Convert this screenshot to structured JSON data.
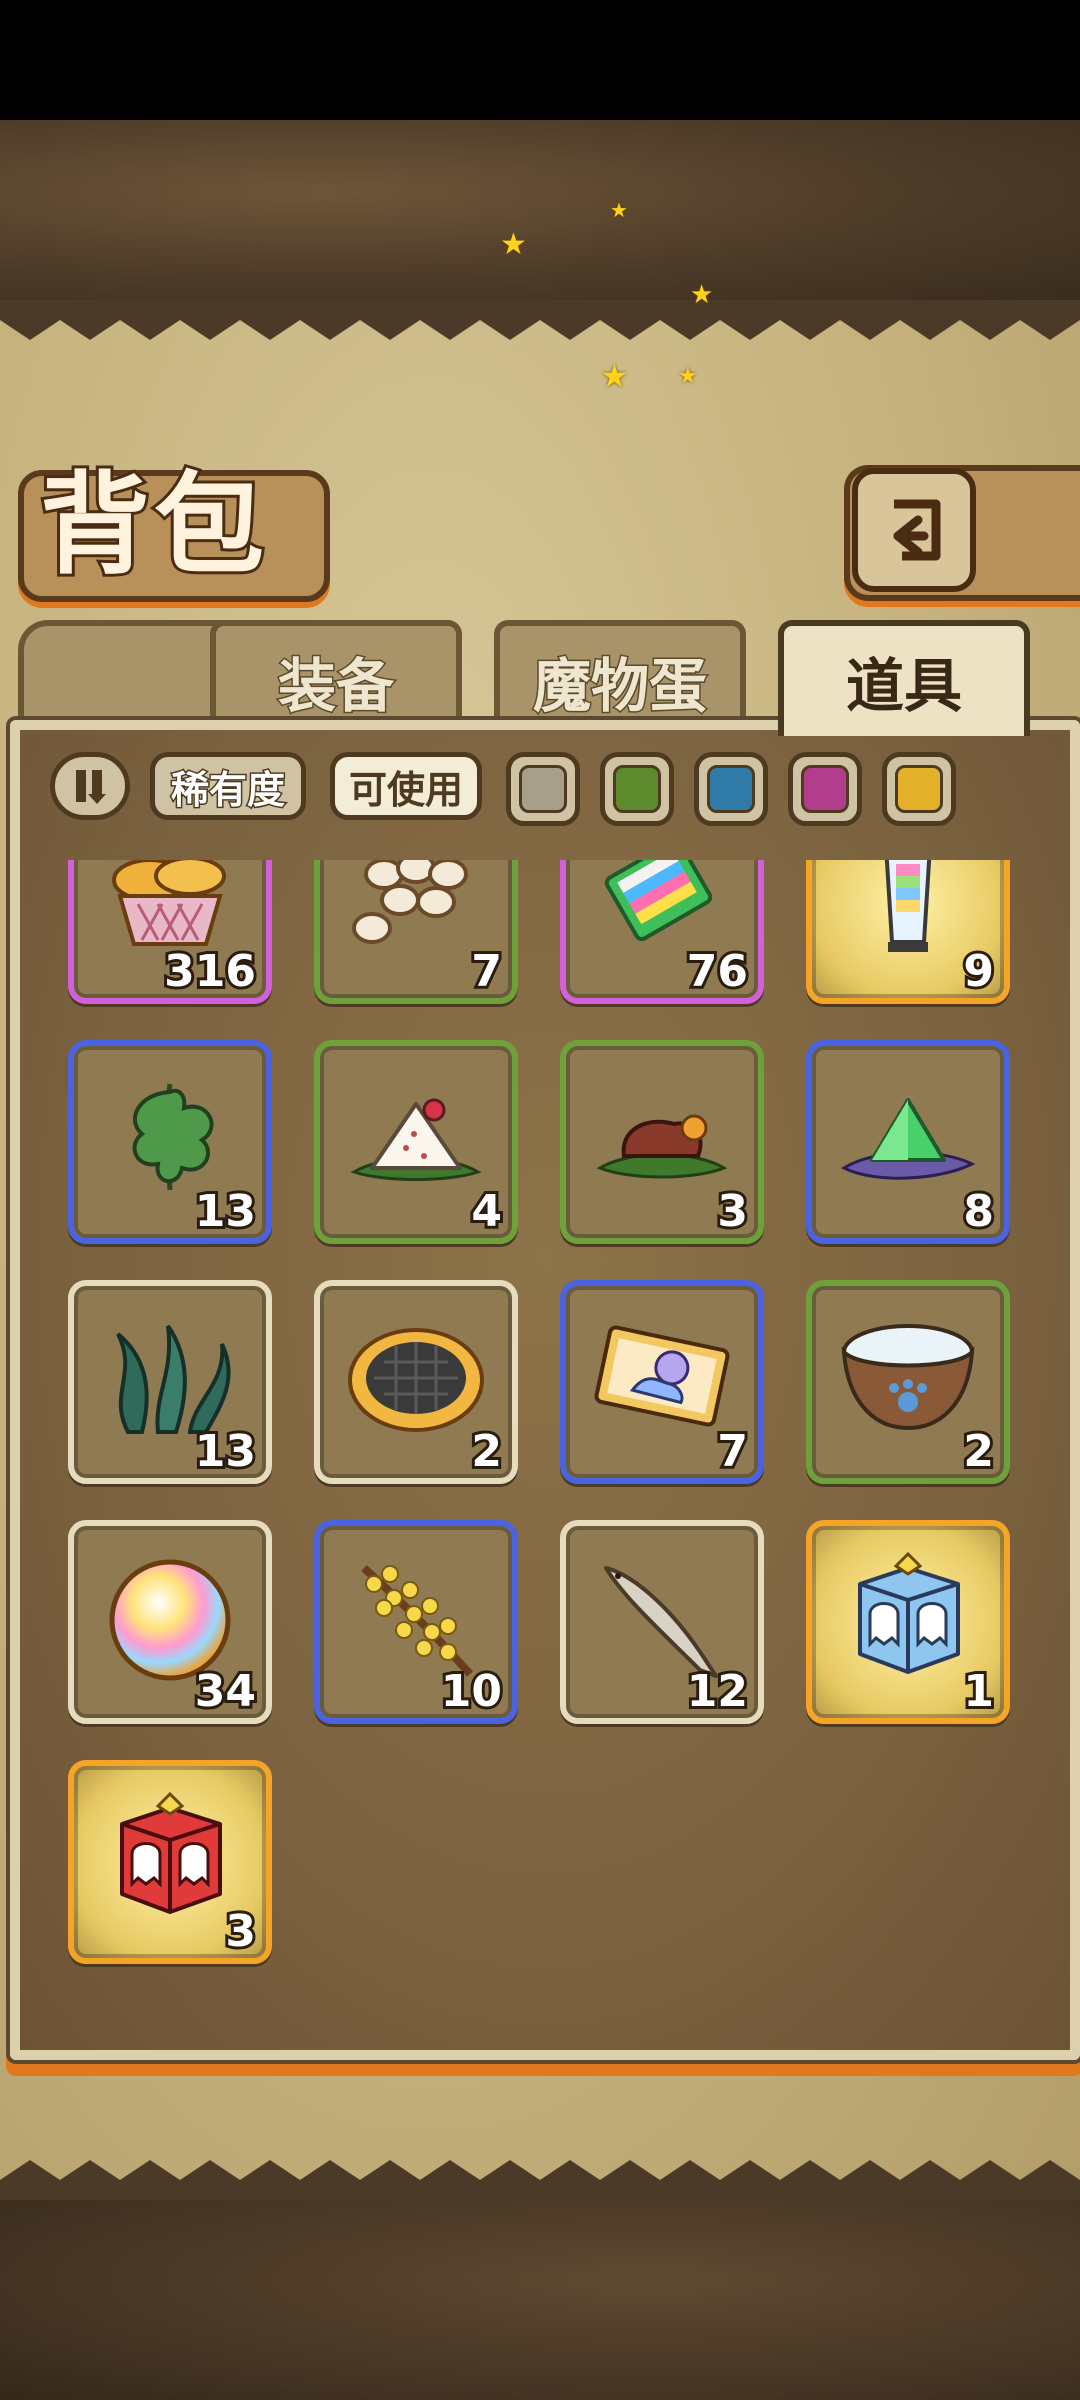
{
  "header": {
    "title": "背包"
  },
  "tabs": [
    {
      "label": "装备",
      "active": false
    },
    {
      "label": "魔物蛋",
      "active": false
    },
    {
      "label": "道具",
      "active": true
    }
  ],
  "filters": {
    "sort_icon": "sort-toggle-icon",
    "rarity_label": "稀有度",
    "usable_label": "可使用",
    "rarity_colors": [
      "#a79f8a",
      "#5c8a2c",
      "#2f7aa6",
      "#b23d8c",
      "#e3b02a"
    ]
  },
  "items": [
    {
      "name": "bread-basket",
      "count": "316",
      "rarity": "purple"
    },
    {
      "name": "eggs",
      "count": "7",
      "rarity": "green"
    },
    {
      "name": "rainbow-candy-bar",
      "count": "76",
      "rarity": "purple"
    },
    {
      "name": "rainbow-lantern",
      "count": "9",
      "rarity": "gold"
    },
    {
      "name": "herb-leaf",
      "count": "13",
      "rarity": "blue"
    },
    {
      "name": "rice-ball",
      "count": "4",
      "rarity": "green"
    },
    {
      "name": "roasted-meat",
      "count": "3",
      "rarity": "green"
    },
    {
      "name": "green-crystal",
      "count": "8",
      "rarity": "blue"
    },
    {
      "name": "seaweed",
      "count": "13",
      "rarity": "white"
    },
    {
      "name": "cookie-tart",
      "count": "2",
      "rarity": "white"
    },
    {
      "name": "snail-ticket",
      "count": "7",
      "rarity": "blue"
    },
    {
      "name": "paw-bowl",
      "count": "2",
      "rarity": "green"
    },
    {
      "name": "rainbow-orb",
      "count": "34",
      "rarity": "white"
    },
    {
      "name": "golden-flower-branch",
      "count": "10",
      "rarity": "blue"
    },
    {
      "name": "dried-fish",
      "count": "12",
      "rarity": "white"
    },
    {
      "name": "blue-ghost-box",
      "count": "1",
      "rarity": "gold"
    },
    {
      "name": "red-ghost-box",
      "count": "3",
      "rarity": "gold"
    }
  ]
}
